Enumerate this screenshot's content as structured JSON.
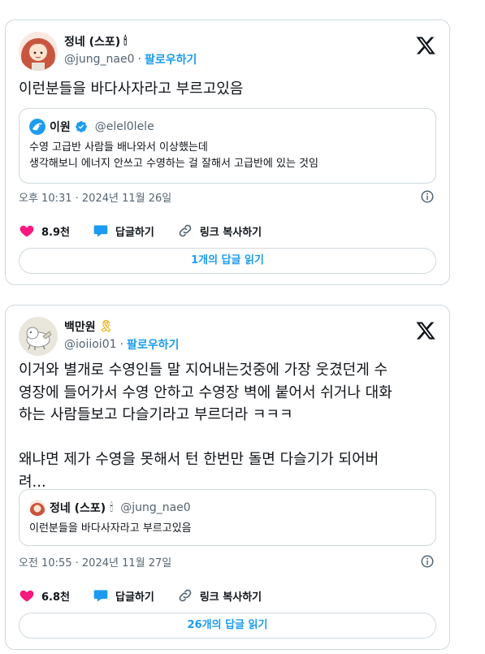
{
  "tweets": [
    {
      "author": {
        "name": "정네 (스포)",
        "badge_emoji": "🕯",
        "handle": "@jung_nae0",
        "separator": "·",
        "follow_label": "팔로우하기"
      },
      "text": "이런분들을 바다사자라고 부르고있음",
      "quote": {
        "name": "이원",
        "verified": true,
        "handle": "@elel0lele",
        "text": "수영 고급반 사람들 배나와서 이상했는데\n생각해보니 에너지 안쓰고 수영하는 걸 잘해서 고급반에 있는 것임"
      },
      "timestamp": "오후 10:31 · 2024년 11월 26일",
      "likes": "8.9천",
      "reply_label": "답글하기",
      "copy_link_label": "링크 복사하기",
      "read_replies_label": "1개의 답글 읽기"
    },
    {
      "author": {
        "name": "백만원",
        "badge_emoji": "🎗",
        "handle": "@ioiioi01",
        "separator": "·",
        "follow_label": "팔로우하기"
      },
      "text": "이거와 별개로 수영인들 말 지어내는것중에 가장 웃겼던게 수\n영장에 들어가서 수영 안하고 수영장 벽에 붙어서 쉬거나 대화\n하는 사람들보고 다슬기라고 부르더라 ㅋㅋㅋ\n\n왜냐면 제가 수영을 못해서 턴 한번만 돌면 다슬기가 되어버\n려...",
      "quote": {
        "name": "정네 (스포)",
        "badge_emoji": "🕯",
        "handle": "@jung_nae0",
        "text": "이런분들을 바다사자라고 부르고있음"
      },
      "timestamp": "오전 10:55 · 2024년 11월 27일",
      "likes": "6.8천",
      "reply_label": "답글하기",
      "copy_link_label": "링크 복사하기",
      "read_replies_label": "26개의 답글 읽기"
    }
  ],
  "icons": {
    "brand": "x-logo-icon",
    "like": "heart-icon",
    "reply": "speech-bubble-icon",
    "link": "link-icon",
    "info": "info-icon",
    "verified": "verified-badge-icon"
  },
  "colors": {
    "accent": "#1d9bf0",
    "like": "#f91880",
    "text": "#0f1419",
    "secondary": "#536471",
    "border": "#cfd9de"
  }
}
